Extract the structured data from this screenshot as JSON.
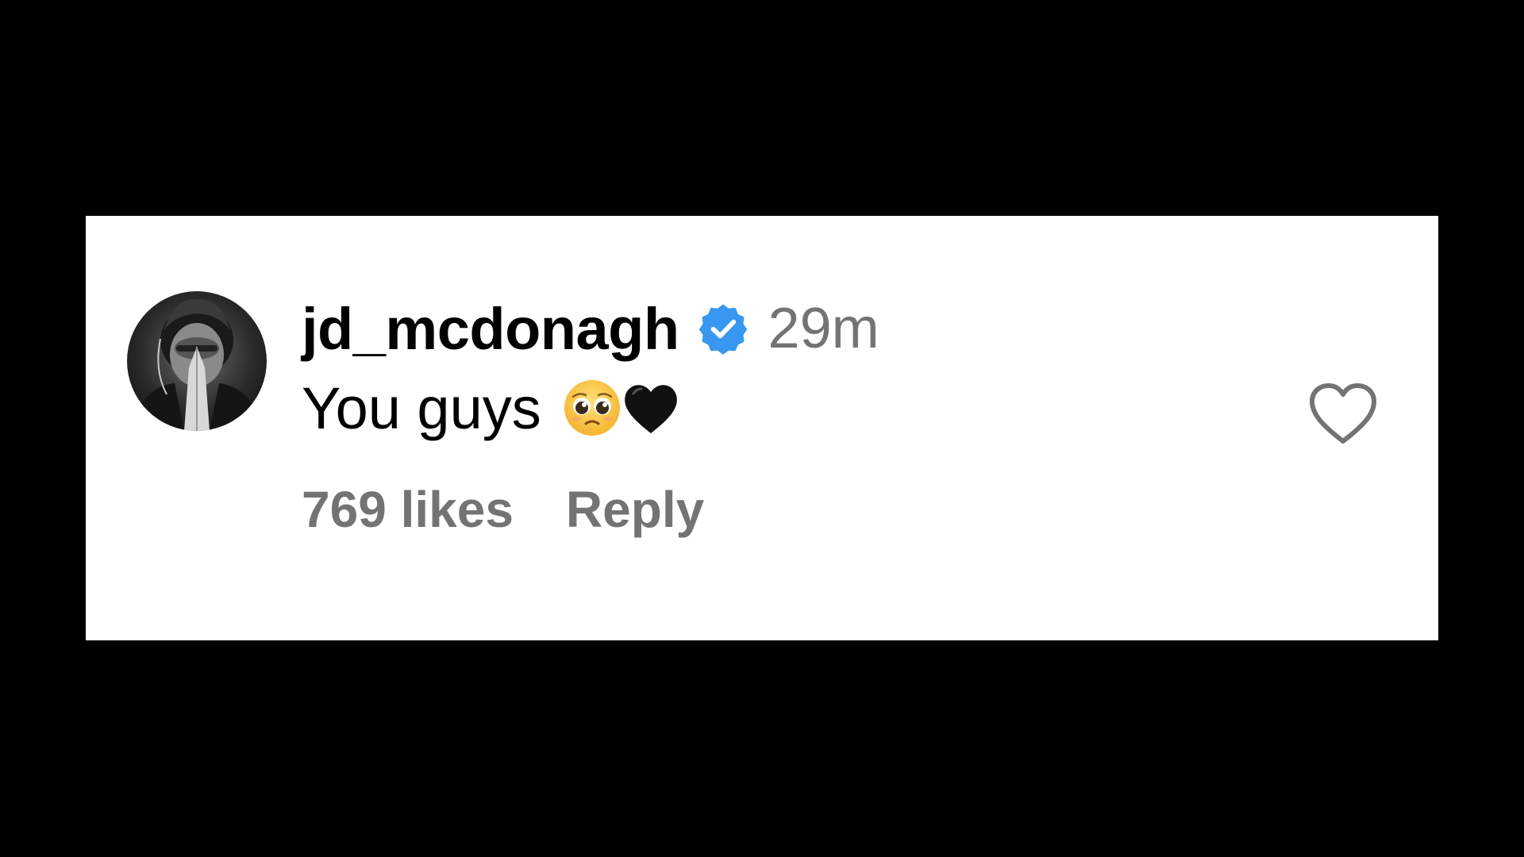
{
  "comment": {
    "username": "jd_mcdonagh",
    "timestamp": "29m",
    "text": "You guys",
    "emojis": [
      "pleading-face-emoji",
      "black-heart-emoji"
    ],
    "likes_label": "769 likes",
    "reply_label": "Reply",
    "verified": true
  },
  "colors": {
    "background": "#000000",
    "card": "#ffffff",
    "username": "#000000",
    "secondary_text": "#737373",
    "verified_badge": "#3897f0"
  },
  "icons": {
    "verified": "verified-badge-icon",
    "like": "heart-outline-icon"
  }
}
